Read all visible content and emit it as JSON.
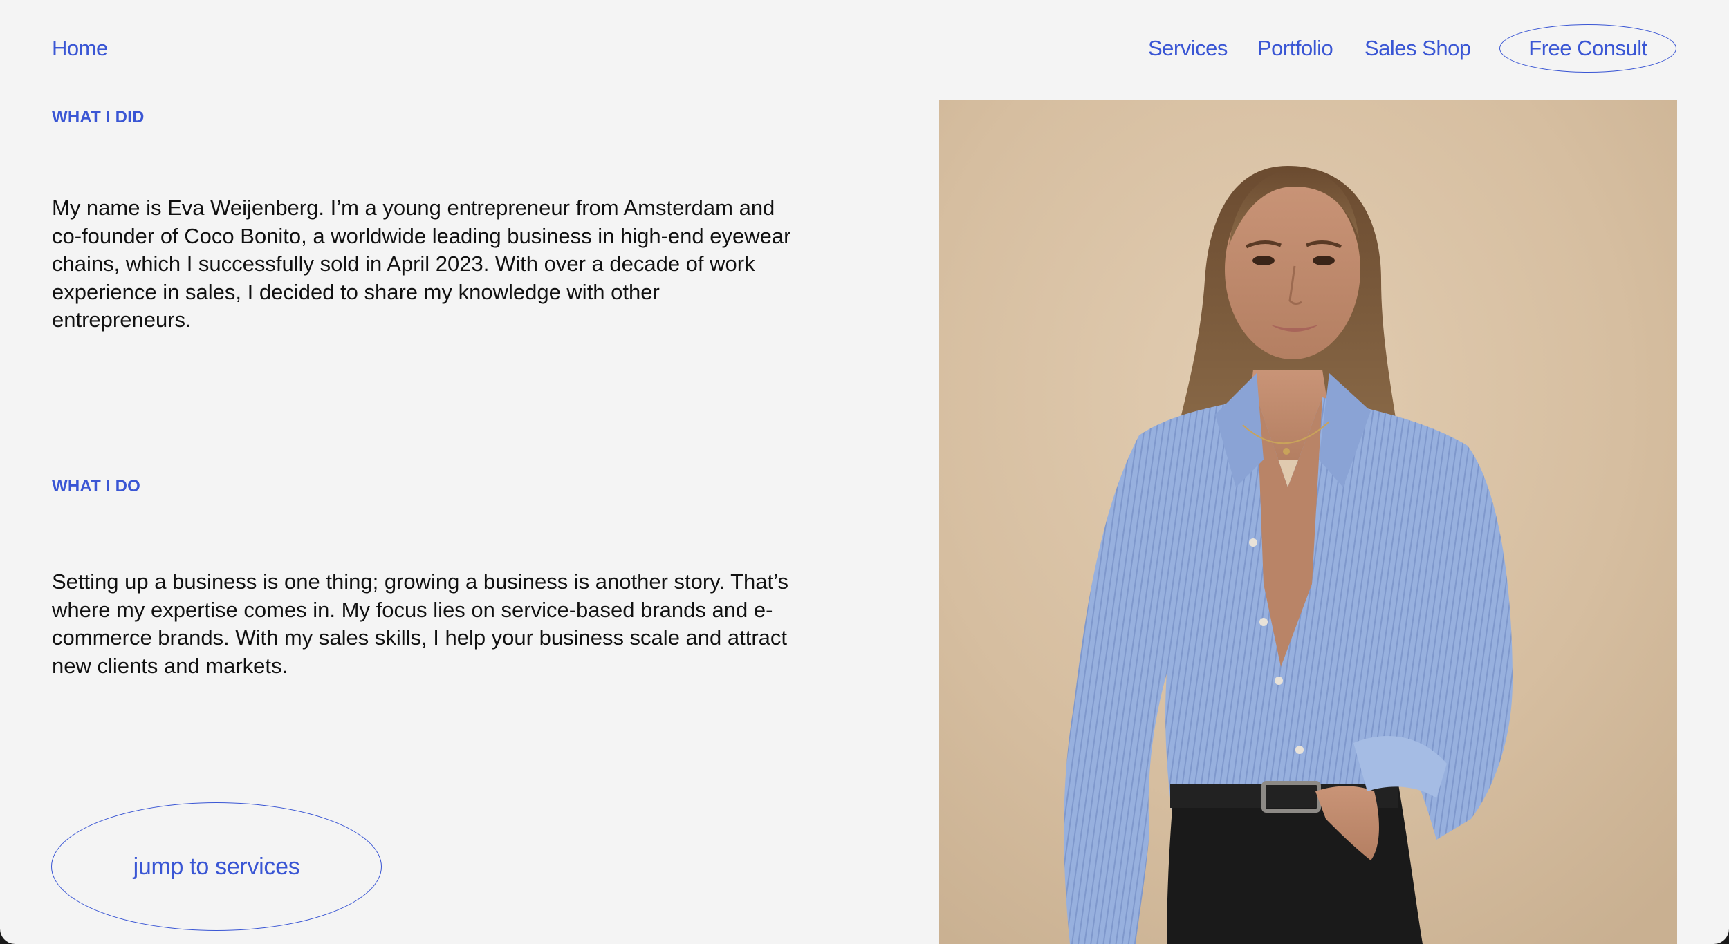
{
  "nav": {
    "home": "Home",
    "services": "Services",
    "portfolio": "Portfolio",
    "sales_shop": "Sales Shop",
    "free_consult": "Free Consult"
  },
  "what_i_did": {
    "heading": "WHAT I DID",
    "body": "My name is Eva Weijenberg. I’m a young entrepreneur from Amsterdam and co-founder of Coco Bonito, a worldwide leading business in high-end eyewear chains, which I successfully sold in April 2023. With over a decade of work experience in sales, I decided to share my knowledge with other entrepreneurs."
  },
  "what_i_do": {
    "heading": "WHAT I DO",
    "body": "Setting up a business is one thing; growing a business is another story. That’s where my expertise comes in. My focus lies on service-based brands and e-commerce brands. With my sales skills, I help your business scale and attract new clients and markets."
  },
  "cta": {
    "jump_label": "jump to services"
  },
  "colors": {
    "accent": "#3a56d4",
    "background": "#f4f4f4",
    "text": "#111111",
    "photo_backdrop": "#d4bc9e",
    "shirt": "#8ea8d8"
  }
}
